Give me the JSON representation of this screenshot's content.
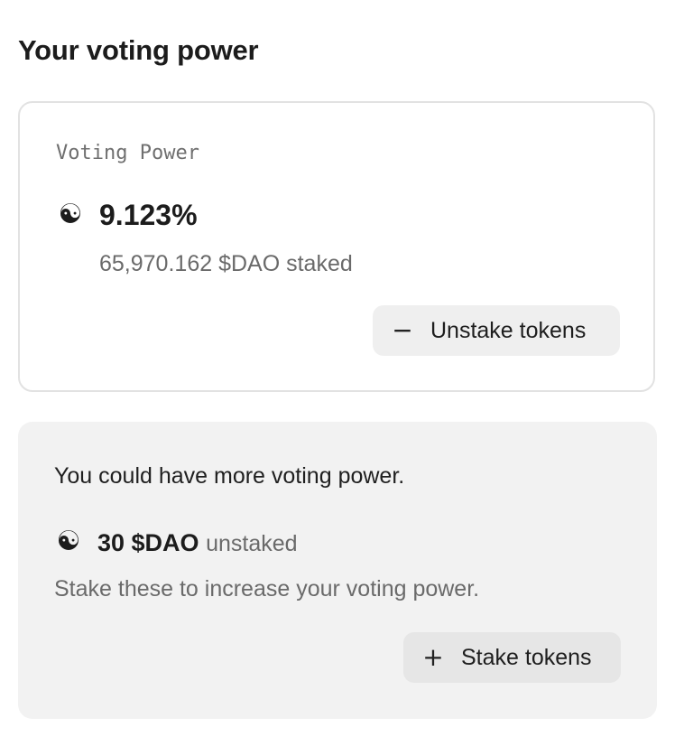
{
  "page": {
    "title": "Your voting power"
  },
  "staked_card": {
    "label": "Voting Power",
    "icon": "yin-yang-icon",
    "percentage": "9.123%",
    "staked_text": "65,970.162 $DAO staked",
    "unstake_button": {
      "icon": "minus-icon",
      "label": "Unstake tokens"
    }
  },
  "unstaked_card": {
    "heading": "You could have more voting power.",
    "icon": "yin-yang-icon",
    "amount": "30 $DAO",
    "amount_suffix": "unstaked",
    "hint": "Stake these to increase your voting power.",
    "stake_button": {
      "icon": "plus-icon",
      "label": "Stake tokens"
    }
  }
}
